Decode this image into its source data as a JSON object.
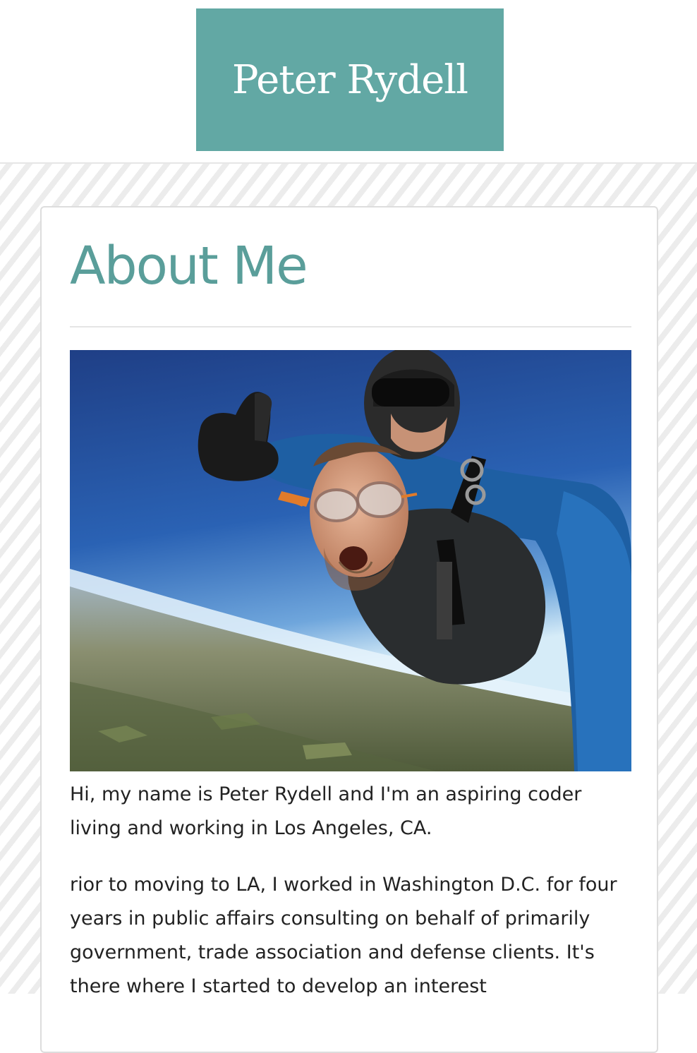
{
  "header": {
    "site_title": "Peter Rydell"
  },
  "about": {
    "heading": "About Me",
    "photo_alt": "Tandem skydive selfie",
    "paragraphs": [
      "Hi, my name is Peter Rydell and I'm an aspiring coder living and working in Los Angeles, CA.",
      "rior to moving to LA, I worked in Washington D.C. for four years in public affairs consulting on behalf of primarily government, trade association and defense clients. It's there where I started to develop an interest"
    ]
  },
  "colors": {
    "accent": "#62a8a4",
    "heading": "#5a9e9a",
    "text": "#222222",
    "pattern": "#ececec"
  }
}
